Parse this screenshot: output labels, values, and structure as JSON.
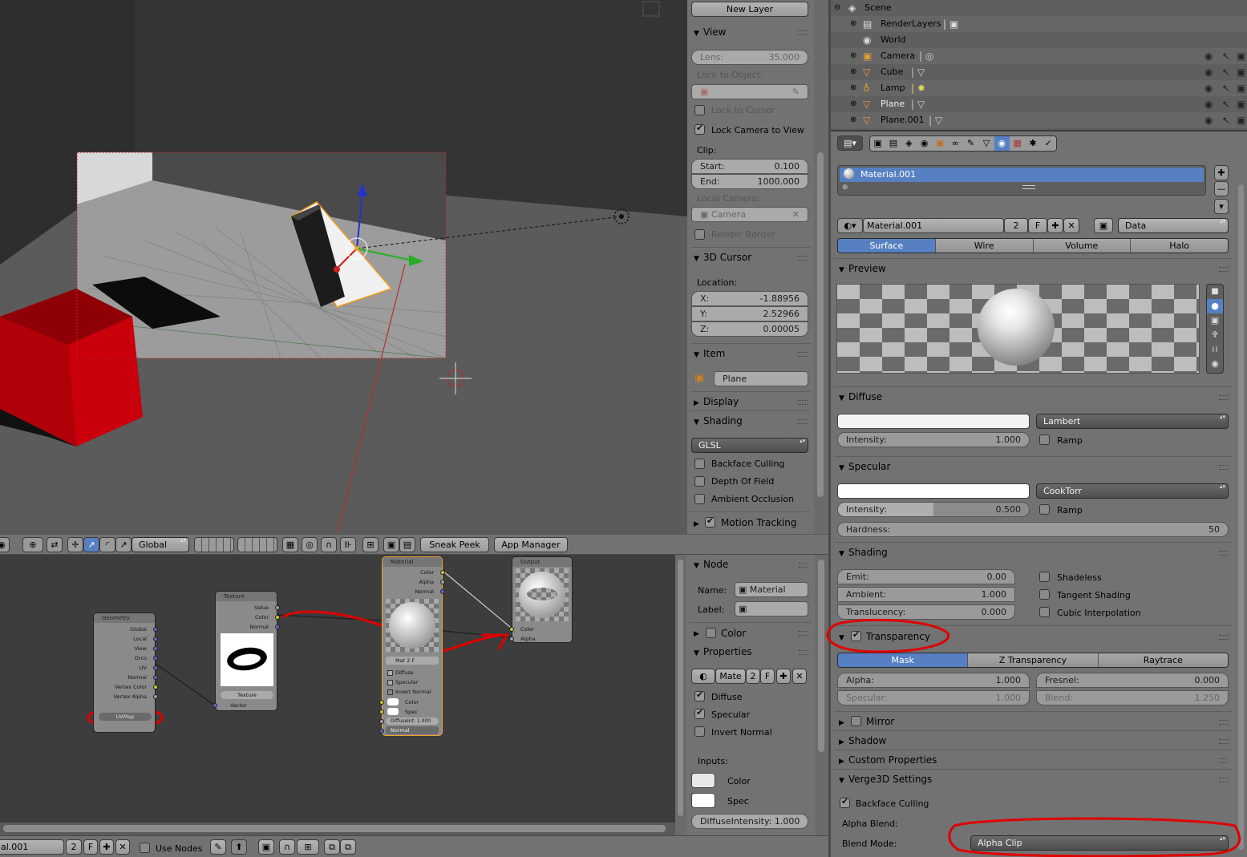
{
  "viewport": {
    "orientation": "Global",
    "buttons": {
      "sneak_peek": "Sneak Peek",
      "app_manager": "App Manager"
    }
  },
  "npanel": {
    "new_layer": "New Layer",
    "view": {
      "header": "View",
      "lens_label": "Lens:",
      "lens_value": "35.000",
      "lock_to_object": "Lock to Object:",
      "lock_to_cursor": "Lock to Cursor",
      "lock_camera": "Lock Camera to View",
      "clip": "Clip:",
      "clip_start_label": "Start:",
      "clip_start": "0.100",
      "clip_end_label": "End:",
      "clip_end": "1000.000",
      "local_camera": "Local Camera:",
      "camera_field": "Camera",
      "render_border": "Render Border"
    },
    "cursor": {
      "header": "3D Cursor",
      "location": "Location:",
      "x_label": "X:",
      "x": "-1.88956",
      "y_label": "Y:",
      "y": "2.52966",
      "z_label": "Z:",
      "z": "0.00005"
    },
    "item": {
      "header": "Item",
      "name": "Plane"
    },
    "display": {
      "header": "Display"
    },
    "shading": {
      "header": "Shading",
      "mode": "GLSL",
      "backface": "Backface Culling",
      "dof": "Depth Of Field",
      "ao": "Ambient Occlusion"
    },
    "motion": {
      "header": "Motion Tracking"
    }
  },
  "node_editor": {
    "geometry": {
      "title": "Geometry",
      "outputs": [
        "Global",
        "Local",
        "View",
        "Orco",
        "UV",
        "Normal",
        "Vertex Color",
        "Vertex Alpha"
      ],
      "uvmap": "UVMap"
    },
    "texture": {
      "title": "Texture",
      "outputs": [
        "Value",
        "Color",
        "Normal"
      ],
      "field": "Texture",
      "input": "Vector"
    },
    "material": {
      "title": "Material",
      "outputs": [
        "Color",
        "Alpha",
        "Normal"
      ],
      "mat_field": "Mat",
      "mat_num": "2",
      "mat_f": "F",
      "diffuse": "Diffuse",
      "specular": "Specular",
      "invert": "Invert Normal",
      "color": "Color",
      "spec": "Spec",
      "diffint": "DiffuseInt: 1.000",
      "normal": "Normal"
    },
    "output": {
      "title": "Output",
      "inputs": [
        "Color",
        "Alpha"
      ]
    },
    "footer": {
      "mat_name": "al.001",
      "num": "2",
      "f": "F",
      "use_nodes": "Use Nodes"
    }
  },
  "node_panel": {
    "node_header": "Node",
    "name_label": "Name:",
    "name_value": "Material",
    "label_label": "Label:",
    "color_header": "Color",
    "properties_header": "Properties",
    "mat": "Mate",
    "mat_num": "2",
    "mat_f": "F",
    "diffuse": "Diffuse",
    "specular": "Specular",
    "invert": "Invert Normal",
    "inputs": "Inputs:",
    "color": "Color",
    "spec": "Spec",
    "diffint": "DiffuseIntensity: 1.000"
  },
  "outliner": {
    "rows": [
      {
        "name": "Scene",
        "icon": "scene-icon"
      },
      {
        "name": "RenderLayers",
        "icon": "renderlayers-icon"
      },
      {
        "name": "World",
        "icon": "world-icon"
      },
      {
        "name": "Camera",
        "icon": "camera-icon"
      },
      {
        "name": "Cube",
        "icon": "mesh-icon"
      },
      {
        "name": "Lamp",
        "icon": "lamp-icon"
      },
      {
        "name": "Plane",
        "icon": "mesh-icon"
      },
      {
        "name": "Plane.001",
        "icon": "mesh-icon"
      }
    ]
  },
  "properties": {
    "slot": "Material.001",
    "material_name": "Material.001",
    "users": "2",
    "fake": "F",
    "link": "Data",
    "tabs": [
      "Surface",
      "Wire",
      "Volume",
      "Halo"
    ],
    "preview": {
      "header": "Preview"
    },
    "diffuse": {
      "header": "Diffuse",
      "shader": "Lambert",
      "intensity_label": "Intensity:",
      "intensity": "1.000",
      "ramp": "Ramp"
    },
    "specular": {
      "header": "Specular",
      "shader": "CookTorr",
      "intensity_label": "Intensity:",
      "intensity": "0.500",
      "intensity_fraction": 0.5,
      "ramp": "Ramp",
      "hardness_label": "Hardness:",
      "hardness": "50"
    },
    "shading": {
      "header": "Shading",
      "emit_label": "Emit:",
      "emit": "0.00",
      "ambient_label": "Ambient:",
      "ambient": "1.000",
      "translucency_label": "Translucency:",
      "translucency": "0.000",
      "shadeless": "Shadeless",
      "tangent": "Tangent Shading",
      "cubic": "Cubic Interpolation"
    },
    "transparency": {
      "header": "Transparency",
      "tabs": [
        "Mask",
        "Z Transparency",
        "Raytrace"
      ],
      "alpha_label": "Alpha:",
      "alpha": "1.000",
      "fresnel_label": "Fresnel:",
      "fresnel": "0.000",
      "specular_label": "Specular:",
      "specular": "1.000",
      "blend_label": "Blend:",
      "blend": "1.250"
    },
    "mirror": "Mirror",
    "shadow": "Shadow",
    "custom": "Custom Properties",
    "verge": {
      "header": "Verge3D Settings",
      "backface": "Backface Culling",
      "alpha_blend": "Alpha Blend:",
      "blend_mode_label": "Blend Mode:",
      "blend_mode": "Alpha Clip"
    }
  },
  "colors": {
    "accent": "#5680c2",
    "annotation": "#e00000",
    "cube": "#c0000a"
  }
}
